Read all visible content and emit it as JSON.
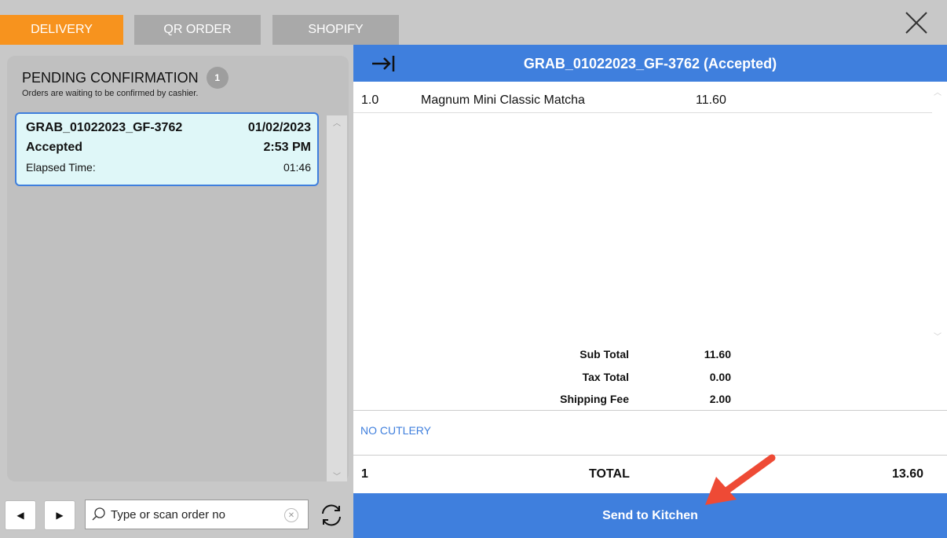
{
  "tabs": [
    {
      "label": "DELIVERY",
      "active": true
    },
    {
      "label": "QR ORDER",
      "active": false
    },
    {
      "label": "SHOPIFY",
      "active": false
    }
  ],
  "pending": {
    "title": "PENDING CONFIRMATION",
    "count": "1",
    "subtitle": "Orders are waiting to be confirmed by cashier."
  },
  "orders": [
    {
      "id": "GRAB_01022023_GF-3762",
      "date": "01/02/2023",
      "status": "Accepted",
      "time": "2:53 PM",
      "elapsed_label": "Elapsed Time:",
      "elapsed": "01:46"
    }
  ],
  "search": {
    "placeholder": "Type or scan order no",
    "value": ""
  },
  "detail": {
    "title": "GRAB_01022023_GF-3762 (Accepted)",
    "items": [
      {
        "qty": "1.0",
        "name": "Magnum Mini Classic Matcha",
        "price": "11.60"
      }
    ],
    "summary": [
      {
        "label": "Sub Total",
        "value": "11.60"
      },
      {
        "label": "Tax Total",
        "value": "0.00"
      },
      {
        "label": "Shipping Fee",
        "value": "2.00"
      }
    ],
    "note": "NO CUTLERY",
    "total_count": "1",
    "total_label": "TOTAL",
    "total_value": "13.60"
  },
  "actions": {
    "send_label": "Send to Kitchen"
  },
  "colors": {
    "accent": "#3f7fdd",
    "active_tab": "#f7931e",
    "annotation_arrow": "#ee4a35"
  },
  "icons": {
    "close": "close-icon",
    "collapse": "collapse-right-icon",
    "search": "search-icon",
    "clear": "clear-icon",
    "refresh": "refresh-icon",
    "prev": "caret-left-icon",
    "next": "caret-right-icon"
  }
}
